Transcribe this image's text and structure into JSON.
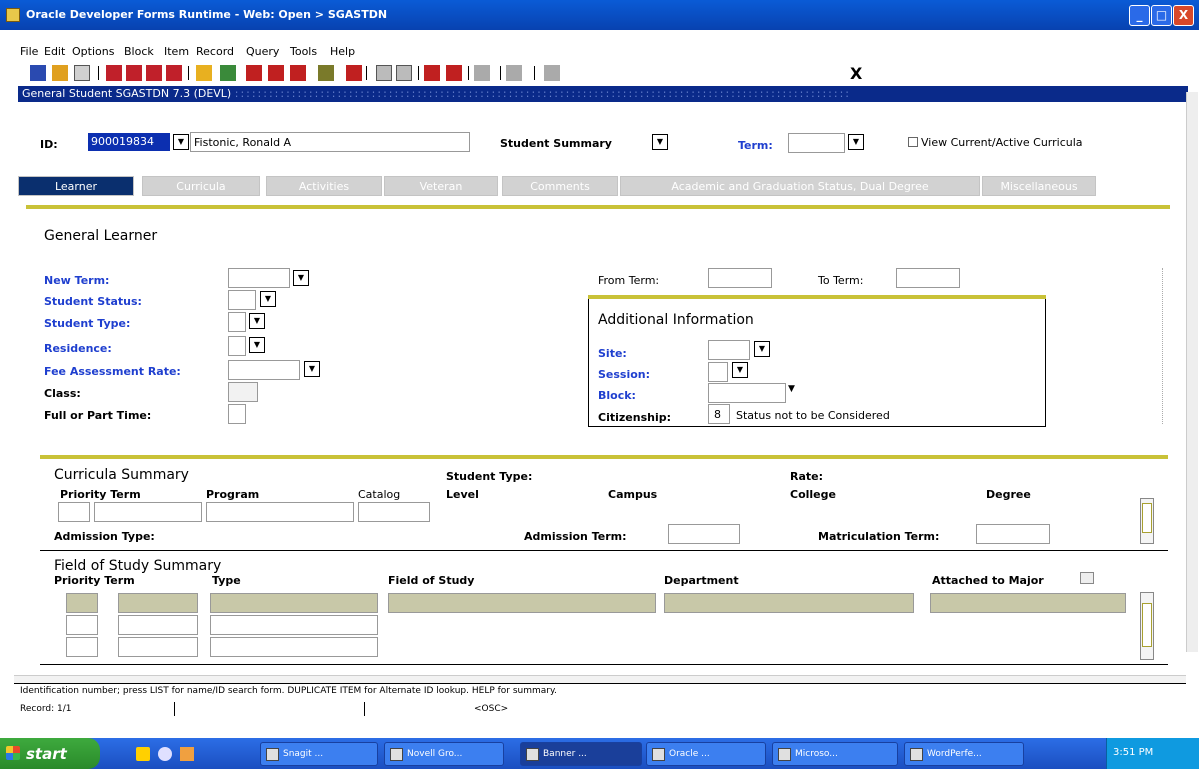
{
  "window": {
    "title": "Oracle Developer Forms Runtime - Web:  Open > SGASTDN",
    "btn_min": "_",
    "btn_max": "□",
    "btn_close": "X"
  },
  "menu": [
    "File",
    "Edit",
    "Options",
    "Block",
    "Item",
    "Record",
    "Query",
    "Tools",
    "Help"
  ],
  "toolbar": {
    "last_icon": "X"
  },
  "form_title": "General Student  SGASTDN  7.3  (DEVL)",
  "header": {
    "id_label": "ID:",
    "id_value": "900019834",
    "name_value": "Fistonic, Ronald A",
    "summary_label": "Student Summary",
    "term_label": "Term:",
    "term_value": "",
    "checkbox_label": "View Current/Active Curricula"
  },
  "tabs": [
    "Learner",
    "Curricula",
    "Activities",
    "Veteran",
    "Comments",
    "Academic and Graduation Status, Dual Degree",
    "Miscellaneous"
  ],
  "learner": {
    "section_title": "General Learner",
    "new_term": "New Term:",
    "student_status": "Student Status:",
    "student_type": "Student Type:",
    "residence": "Residence:",
    "fee_rate": "Fee Assessment Rate:",
    "class": "Class:",
    "full_part_time": "Full or Part Time:",
    "from_term": "From Term:",
    "to_term": "To Term:",
    "from_term_value": "",
    "to_term_value": ""
  },
  "additional": {
    "title": "Additional Information",
    "site": "Site:",
    "session": "Session:",
    "block": "Block:",
    "citizenship": "Citizenship:",
    "citizenship_code": "8",
    "citizenship_desc": "Status not to be Considered"
  },
  "curricula": {
    "title": "Curricula Summary",
    "student_type": "Student Type:",
    "rate": "Rate:",
    "cols": [
      "Priority Term",
      "Program",
      "Catalog",
      "Level",
      "Campus",
      "College",
      "Degree"
    ],
    "admission_type": "Admission Type:",
    "admission_term": "Admission Term:",
    "matriculation_term": "Matriculation Term:"
  },
  "field_of_study": {
    "title": "Field of Study Summary",
    "cols": [
      "Priority Term",
      "Type",
      "Field of Study",
      "Department",
      "Attached to Major"
    ]
  },
  "status": {
    "hint": "Identification number; press LIST for name/ID search form. DUPLICATE ITEM for Alternate ID lookup. HELP for summary.",
    "record": "Record: 1/1",
    "mode": "<OSC>"
  },
  "taskbar": {
    "start": "start",
    "tasks": [
      "Snagit ...",
      "Novell Gro...",
      "Banner ...",
      "Oracle ...",
      "Microso...",
      "WordPerfe..."
    ],
    "clock": "3:51 PM"
  }
}
